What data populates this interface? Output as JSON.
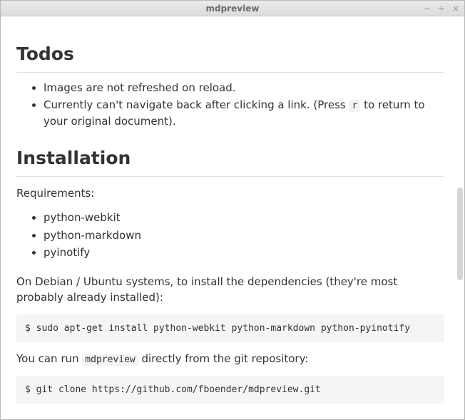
{
  "window": {
    "title": "mdpreview"
  },
  "doc": {
    "h_todos": "Todos",
    "todos_items": [
      "Images are not refreshed on reload.",
      "Currently can't navigate back after clicking a link. (Press "
    ],
    "todos_item2_key": "r",
    "todos_item2_tail": " to return to your original document).",
    "h_install": "Installation",
    "req_label": "Requirements:",
    "req_items": [
      "python-webkit",
      "python-markdown",
      "pyinotify"
    ],
    "debian_p": "On Debian / Ubuntu systems, to install the dependencies (they're most probably already installed):",
    "code_install": "$ sudo apt-get install python-webkit python-markdown python-pyinotify",
    "run_p_pre": "You can run ",
    "run_p_code": "mdpreview",
    "run_p_post": " directly from the git repository:",
    "code_clone": "$ git clone https://github.com/fboender/mdpreview.git"
  }
}
